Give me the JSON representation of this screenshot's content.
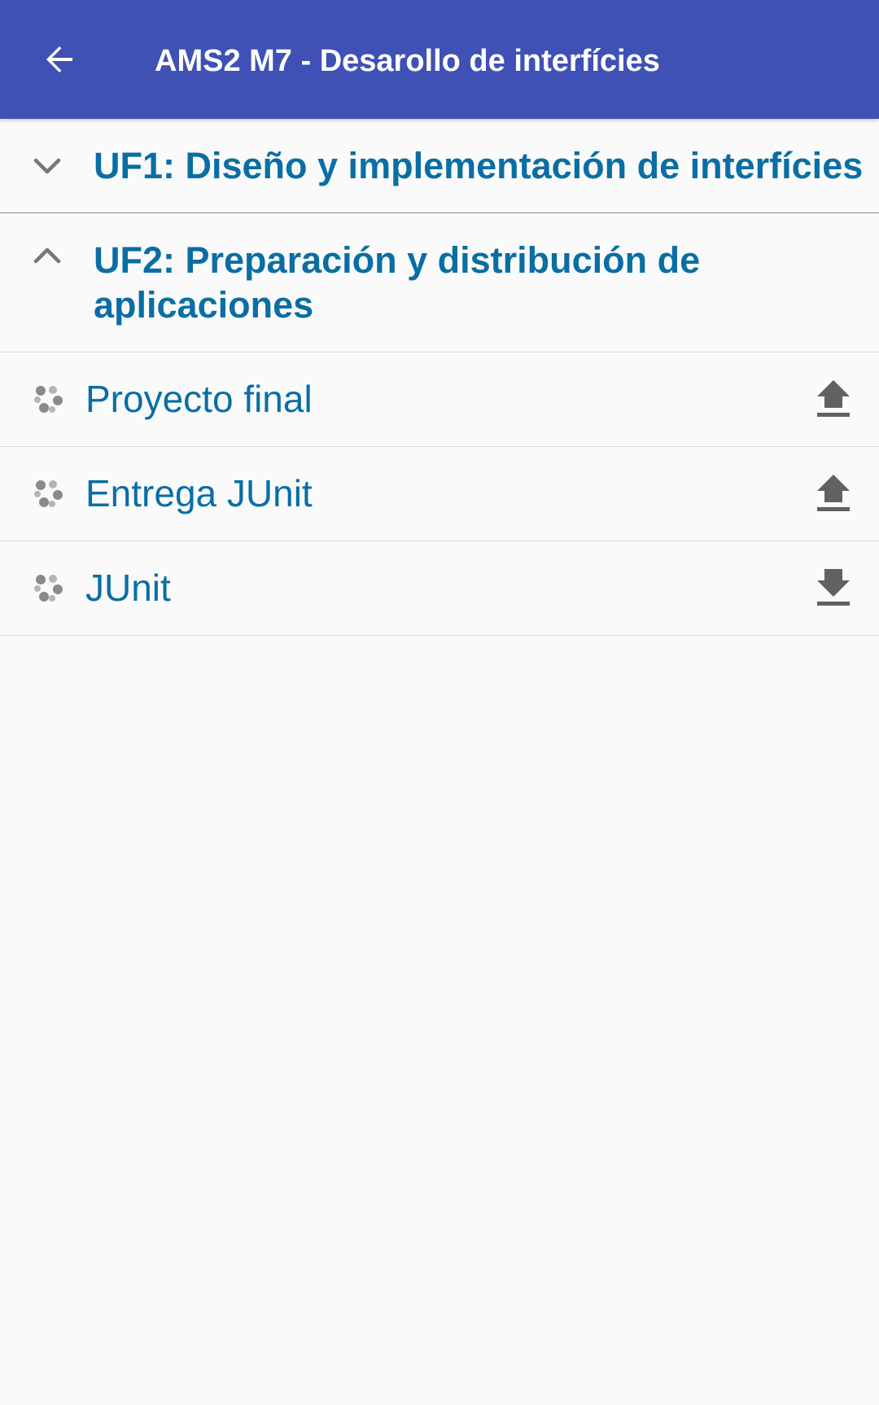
{
  "appbar": {
    "title": "AMS2 M7 - Desarollo de interfícies",
    "background": "#3f51b5"
  },
  "sections": [
    {
      "title": "UF1: Diseño y implementación de interfícies",
      "expanded": false,
      "icon": "chevron-down-icon"
    },
    {
      "title": "UF2: Preparación y distribución de aplicaciones",
      "expanded": true,
      "icon": "chevron-up-icon"
    }
  ],
  "items": [
    {
      "label": "Proyecto final",
      "icon": "activity-icon",
      "action_icon": "upload-icon"
    },
    {
      "label": "Entrega JUnit",
      "icon": "activity-icon",
      "action_icon": "upload-icon"
    },
    {
      "label": "JUnit",
      "icon": "activity-icon",
      "action_icon": "download-icon"
    }
  ],
  "colors": {
    "accent": "#0a6ea4",
    "icon_gray": "#616161",
    "background": "#fafafa"
  }
}
